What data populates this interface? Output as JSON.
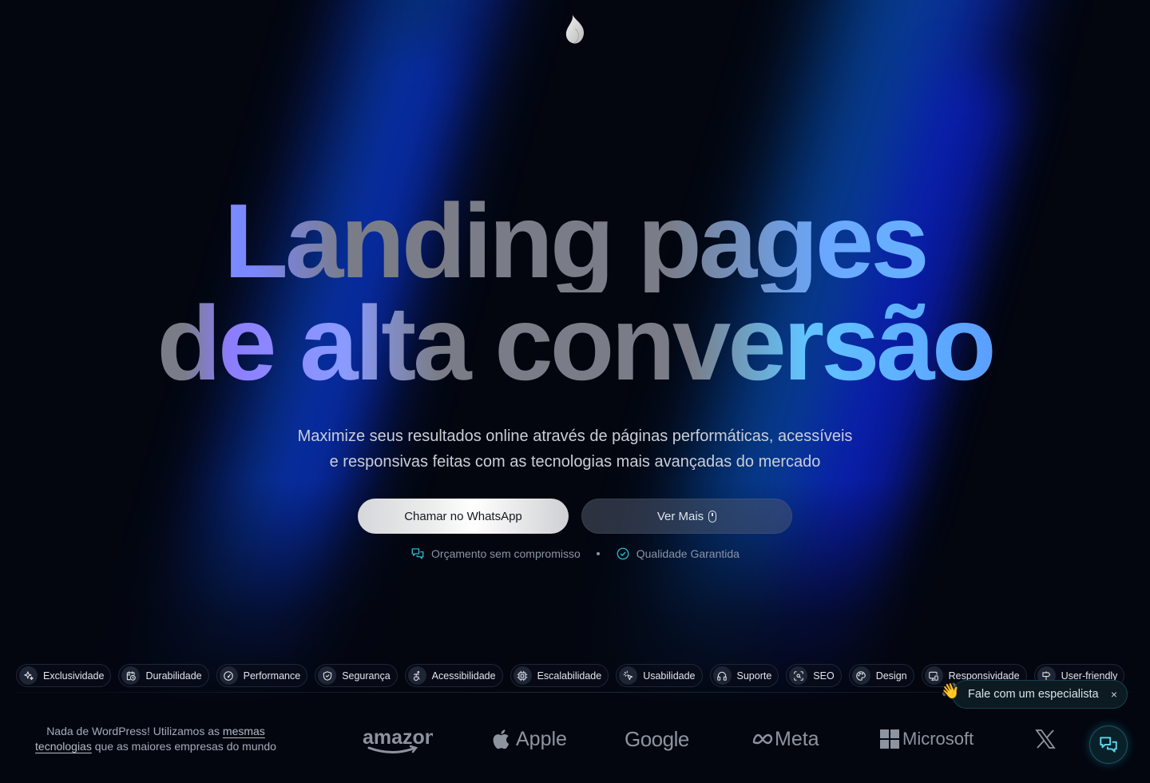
{
  "logo": {
    "icon": "flame-drop-icon"
  },
  "hero": {
    "headline_line1": "Landing pages",
    "headline_line2": "de alta conversão",
    "subtitle_line1": "Maximize seus resultados online através de páginas performáticas, acessíveis",
    "subtitle_line2": "e responsivas feitas com as tecnologias mais avançadas do mercado",
    "primary_button": "Chamar no WhatsApp",
    "secondary_button": "Ver Mais",
    "secondary_button_icon": "mouse-icon",
    "trust_items": [
      {
        "label": "Orçamento sem compromisso",
        "icon": "chat-bubbles-icon"
      },
      {
        "label": "Qualidade Garantida",
        "icon": "check-circle-icon"
      }
    ],
    "accent_color": "#2fb6c9"
  },
  "features": [
    {
      "label": "Exclusividade",
      "icon": "sparkles-icon"
    },
    {
      "label": "Durabilidade",
      "icon": "calendar-clock-icon"
    },
    {
      "label": "Performance",
      "icon": "gauge-icon"
    },
    {
      "label": "Segurança",
      "icon": "shield-check-icon"
    },
    {
      "label": "Acessibilidade",
      "icon": "accessibility-icon"
    },
    {
      "label": "Escalabilidade",
      "icon": "cpu-icon"
    },
    {
      "label": "Usabilidade",
      "icon": "pointer-click-icon"
    },
    {
      "label": "Suporte",
      "icon": "headphones-icon"
    },
    {
      "label": "SEO",
      "icon": "scan-search-icon"
    },
    {
      "label": "Design",
      "icon": "palette-icon"
    },
    {
      "label": "Responsividade",
      "icon": "devices-icon"
    },
    {
      "label": "User-friendly",
      "icon": "signpost-icon"
    }
  ],
  "footer": {
    "tagline_pre": "Nada de WordPress! Utilizamos as ",
    "tagline_link": "mesmas tecnologias",
    "tagline_post": " que as maiores empresas do mundo",
    "brands": [
      "amazon",
      "Apple",
      "Google",
      "Meta",
      "Microsoft",
      "X"
    ]
  },
  "toast": {
    "emoji": "👋",
    "text": "Fale com um especialista",
    "close": "×"
  },
  "chat_button": {
    "icon": "chat-bubbles-icon"
  }
}
